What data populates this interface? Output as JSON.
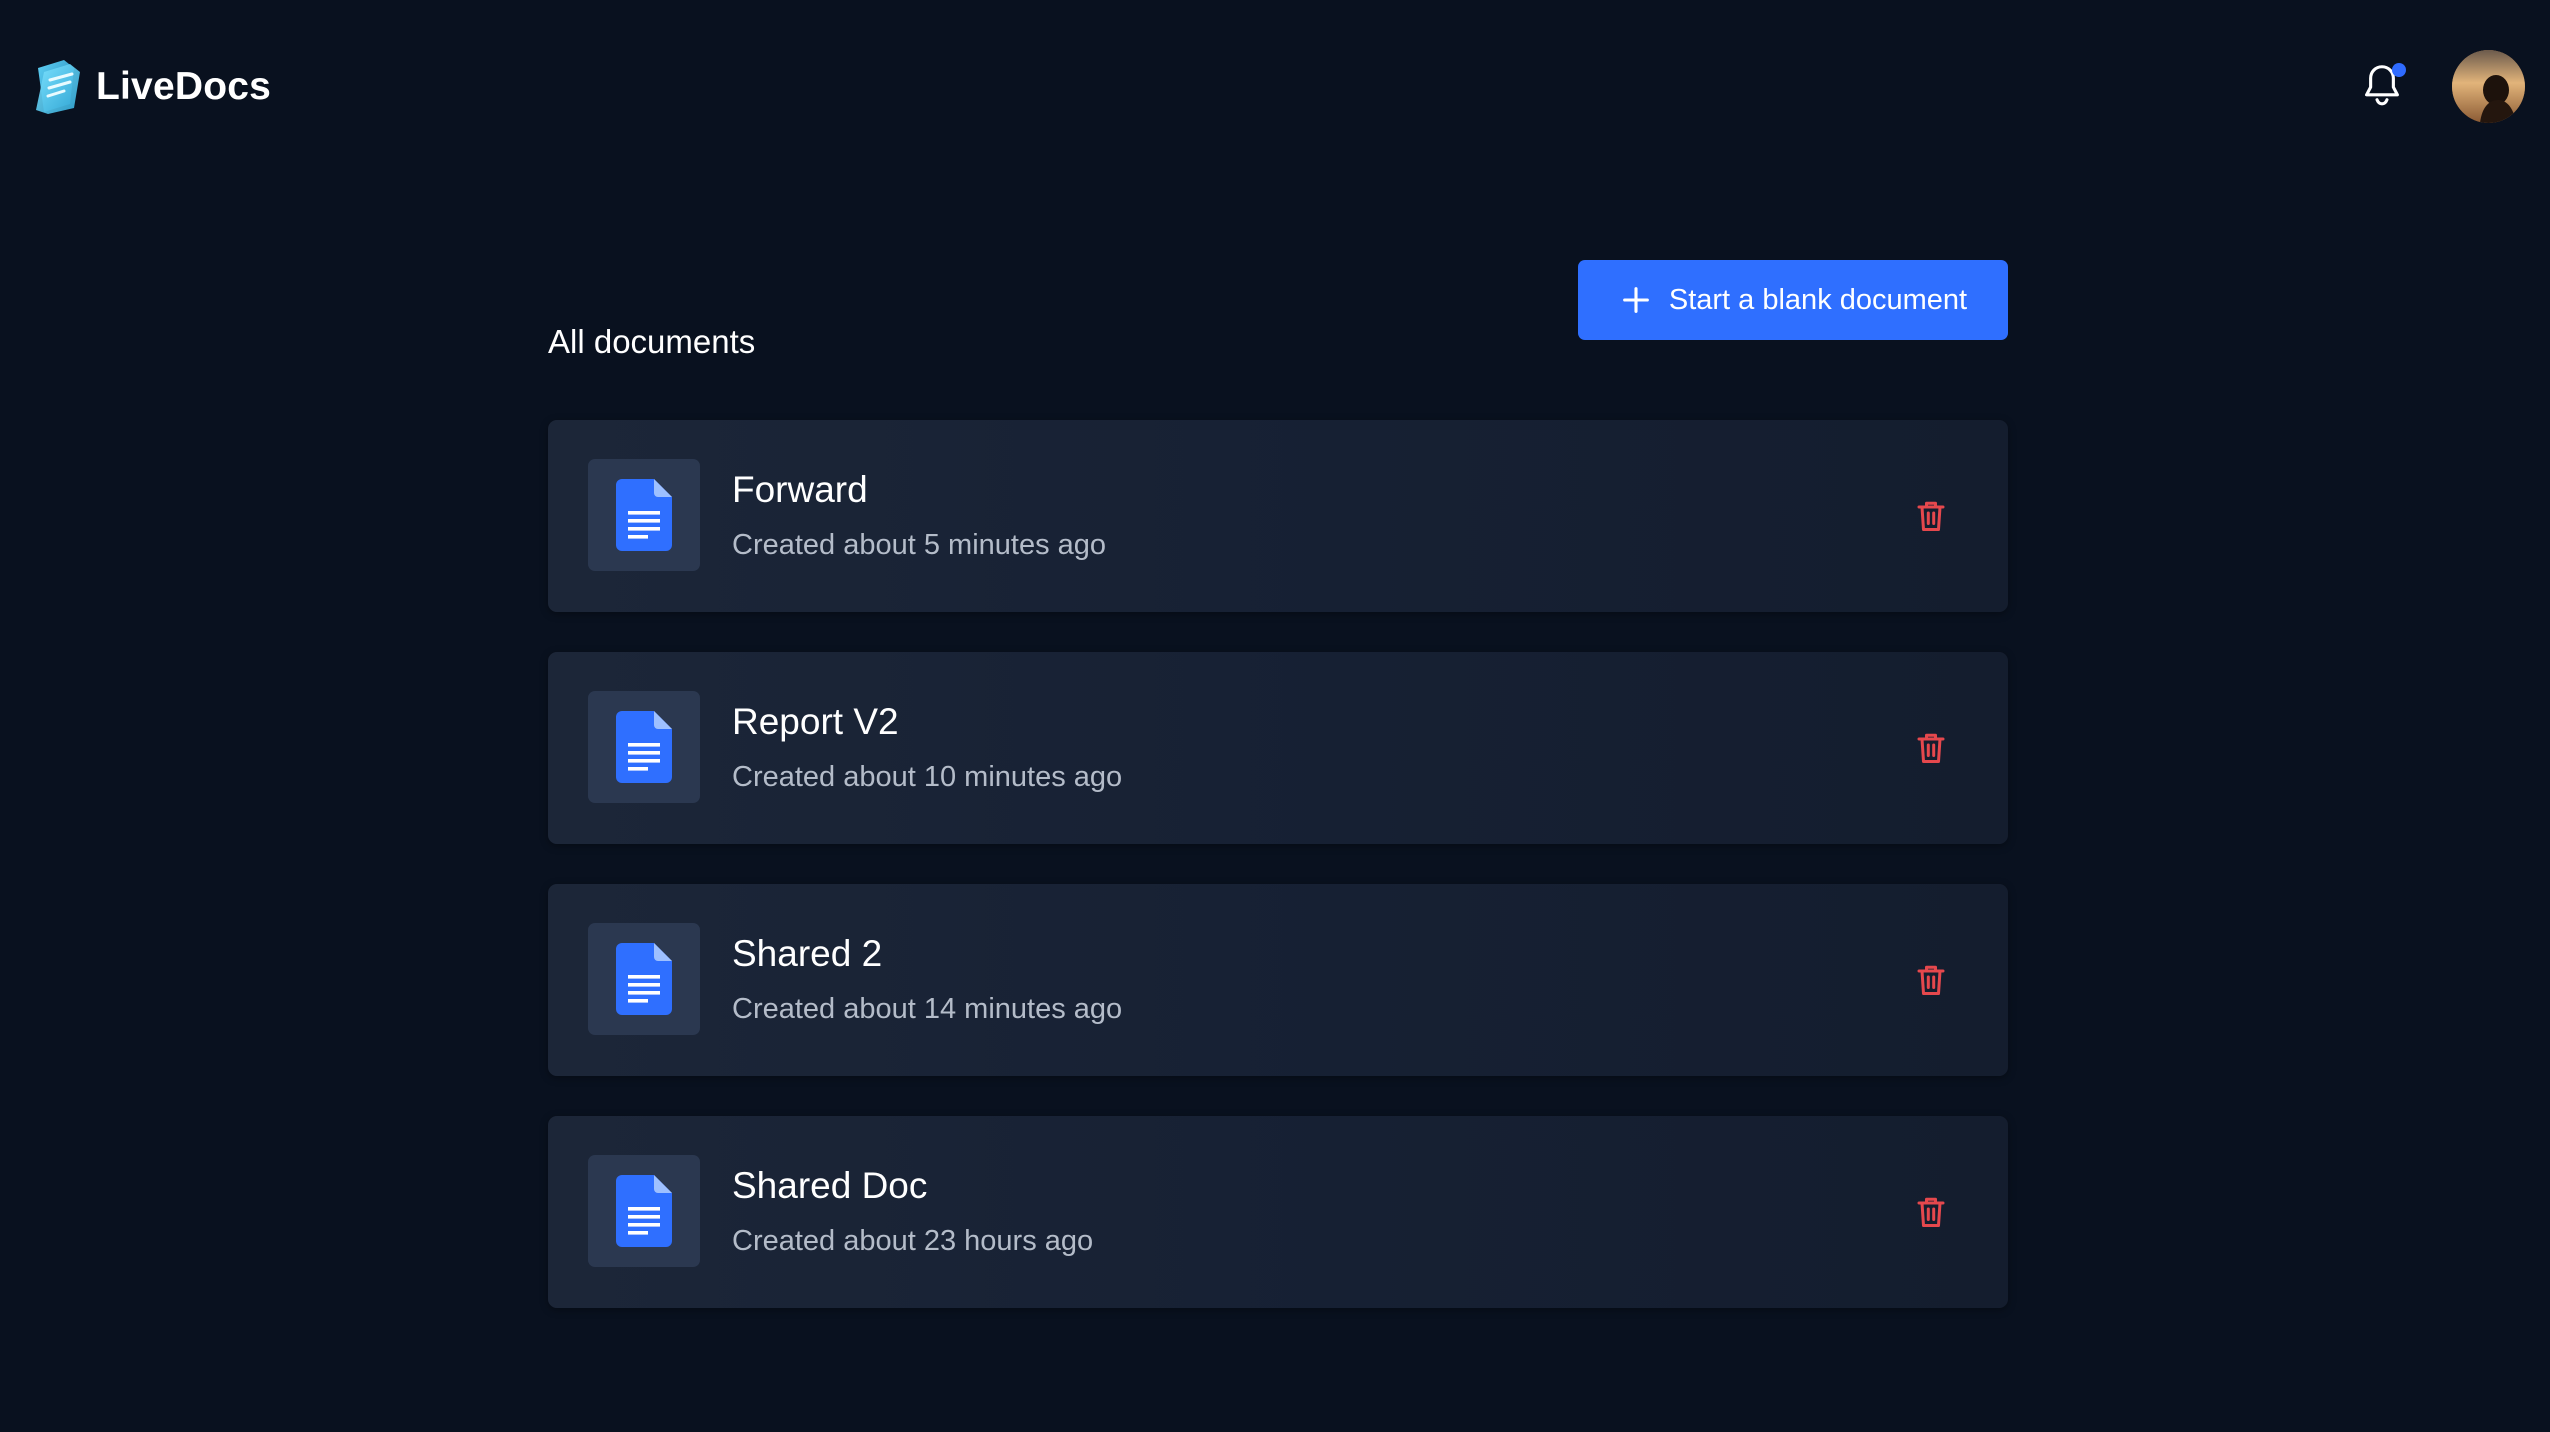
{
  "app": {
    "name": "LiveDocs",
    "logo_icon": "livedocs-logo-icon"
  },
  "header": {
    "notification_icon": "bell-icon",
    "notification_dot_color": "#2f6bff",
    "avatar_icon": "user-avatar"
  },
  "main": {
    "section_title": "All documents",
    "new_document_button": {
      "label": "Start a blank document",
      "icon": "plus-icon",
      "color": "#2f6fff"
    },
    "documents": [
      {
        "title": "Forward",
        "created": "Created about 5 minutes ago",
        "icon": "document-icon",
        "action_icon": "trash-icon"
      },
      {
        "title": "Report V2",
        "created": "Created about 10 minutes ago",
        "icon": "document-icon",
        "action_icon": "trash-icon"
      },
      {
        "title": "Shared 2",
        "created": "Created about 14 minutes ago",
        "icon": "document-icon",
        "action_icon": "trash-icon"
      },
      {
        "title": "Shared Doc",
        "created": "Created about 23 hours ago",
        "icon": "document-icon",
        "action_icon": "trash-icon"
      }
    ]
  },
  "colors": {
    "background": "#09111f",
    "card": "#1a2436",
    "accent": "#2f6fff",
    "danger": "#e5484d",
    "muted_text": "#b4bcc9"
  }
}
